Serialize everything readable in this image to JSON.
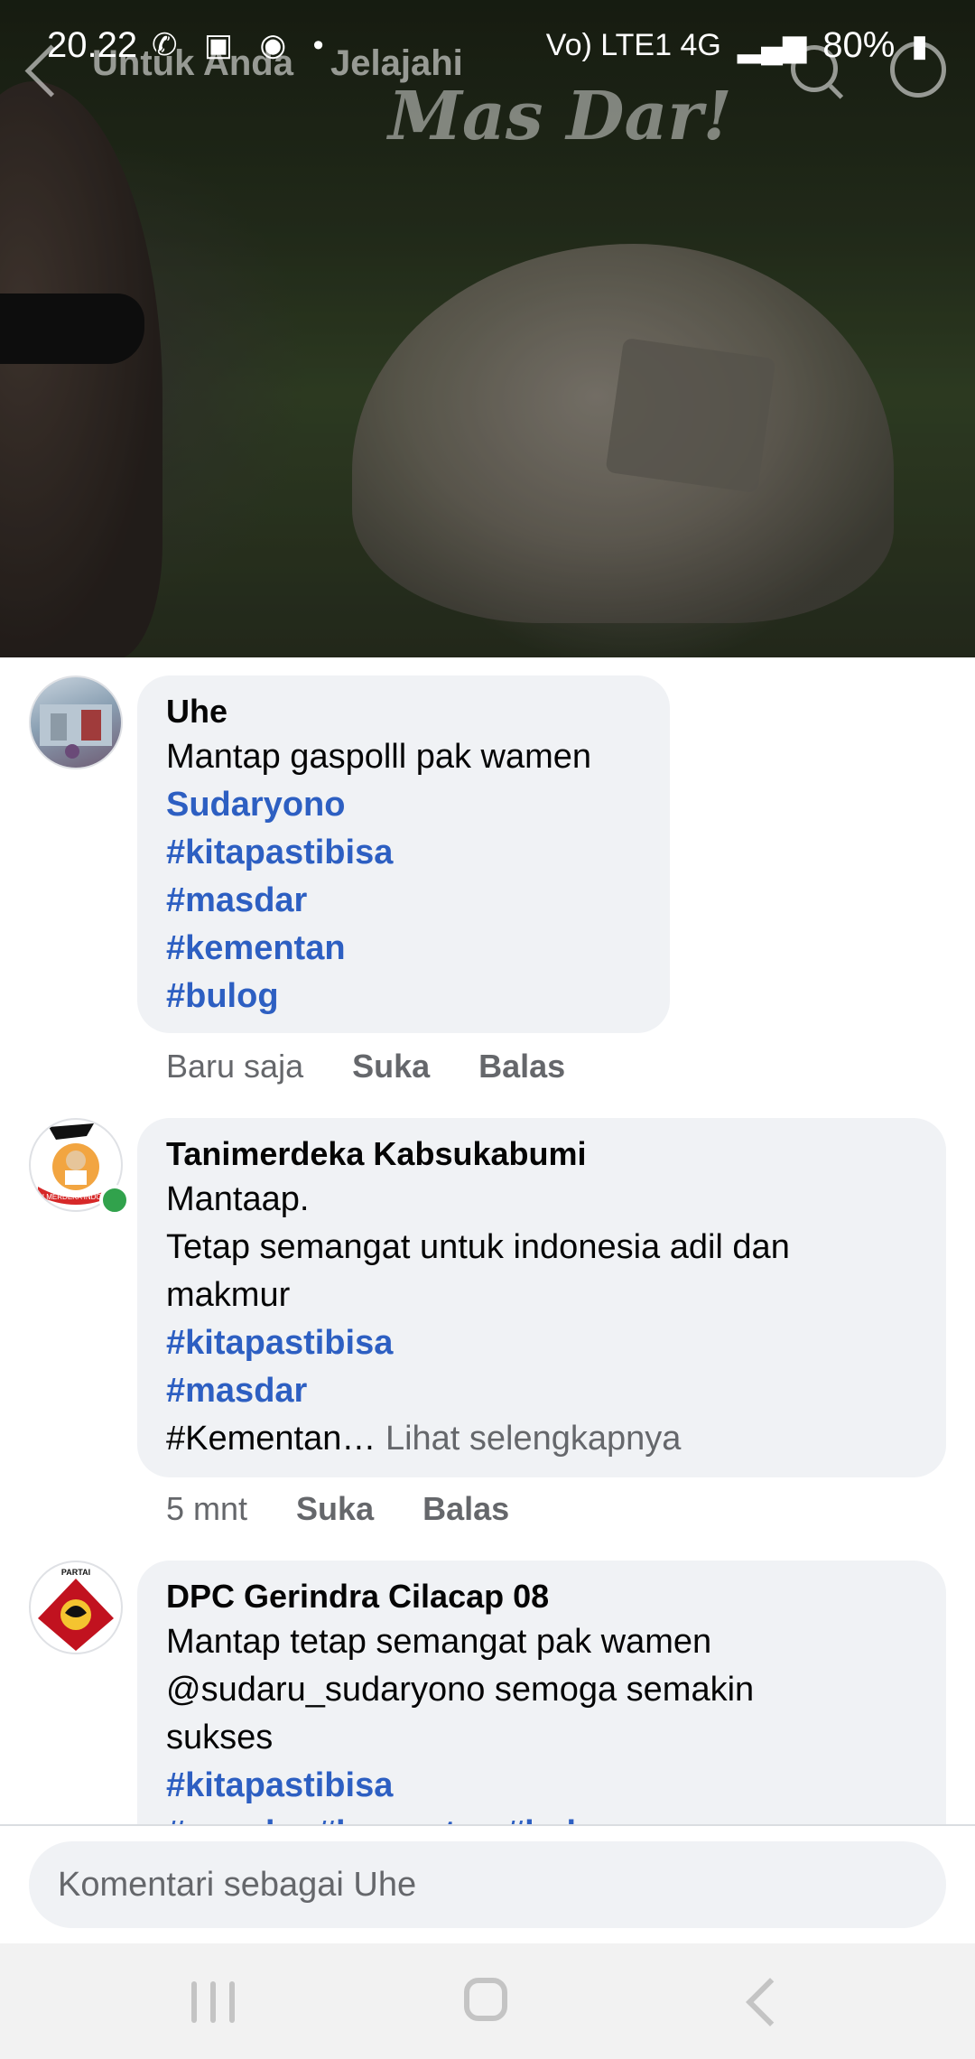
{
  "status_bar": {
    "time": "20.22",
    "icons_left": "✆ ▣ ◉ •",
    "signal_text": "Vo) LTE1 4G",
    "battery": "80%"
  },
  "video_header": {
    "tabs": [
      "Untuk Anda",
      "Jelajahi"
    ],
    "watermark": "Mas Dar!"
  },
  "comments": [
    {
      "author": "Uhe",
      "lines": [
        {
          "text": "Mantap gaspolll pak wamen",
          "style": "text"
        },
        {
          "text": "Sudaryono",
          "style": "tag"
        },
        {
          "text": "#kitapastibisa",
          "style": "tag"
        },
        {
          "text": "#masdar",
          "style": "tag"
        },
        {
          "text": "#kementan",
          "style": "tag"
        },
        {
          "text": "#bulog",
          "style": "tag"
        }
      ],
      "time": "Baru saja",
      "like_label": "Suka",
      "reply_label": "Balas"
    },
    {
      "author": "Tanimerdeka Kabsukabumi",
      "avatar_text": "TANI MERDEKA INDONESIA",
      "lines": [
        {
          "text": "Mantaap.",
          "style": "text"
        },
        {
          "text": "Tetap semangat untuk indonesia adil dan",
          "style": "text"
        },
        {
          "text": "makmur",
          "style": "text"
        },
        {
          "text": "#kitapastibisa",
          "style": "tag"
        },
        {
          "text": "#masdar",
          "style": "tag"
        }
      ],
      "truncated_line": "#Kementan…",
      "see_more": "Lihat selengkapnya",
      "time": "5 mnt",
      "like_label": "Suka",
      "reply_label": "Balas"
    },
    {
      "author": "DPC Gerindra Cilacap 08",
      "avatar_text": "PARTAI",
      "lines": [
        {
          "text": "Mantap tetap semangat pak wamen",
          "style": "text"
        },
        {
          "text": "@sudaru_sudaryono semoga semakin",
          "style": "text"
        },
        {
          "text": "sukses",
          "style": "text"
        },
        {
          "text": "#kitapastibisa",
          "style": "tag"
        },
        {
          "text": "#masdar #kementan #bulog",
          "style": "tag"
        }
      ]
    }
  ],
  "composer": {
    "placeholder": "Komentari sebagai Uhe"
  },
  "colors": {
    "hashtag": "#2d5fc2",
    "bubble": "#f0f2f5",
    "meta": "#65676b",
    "online": "#31a24c"
  }
}
